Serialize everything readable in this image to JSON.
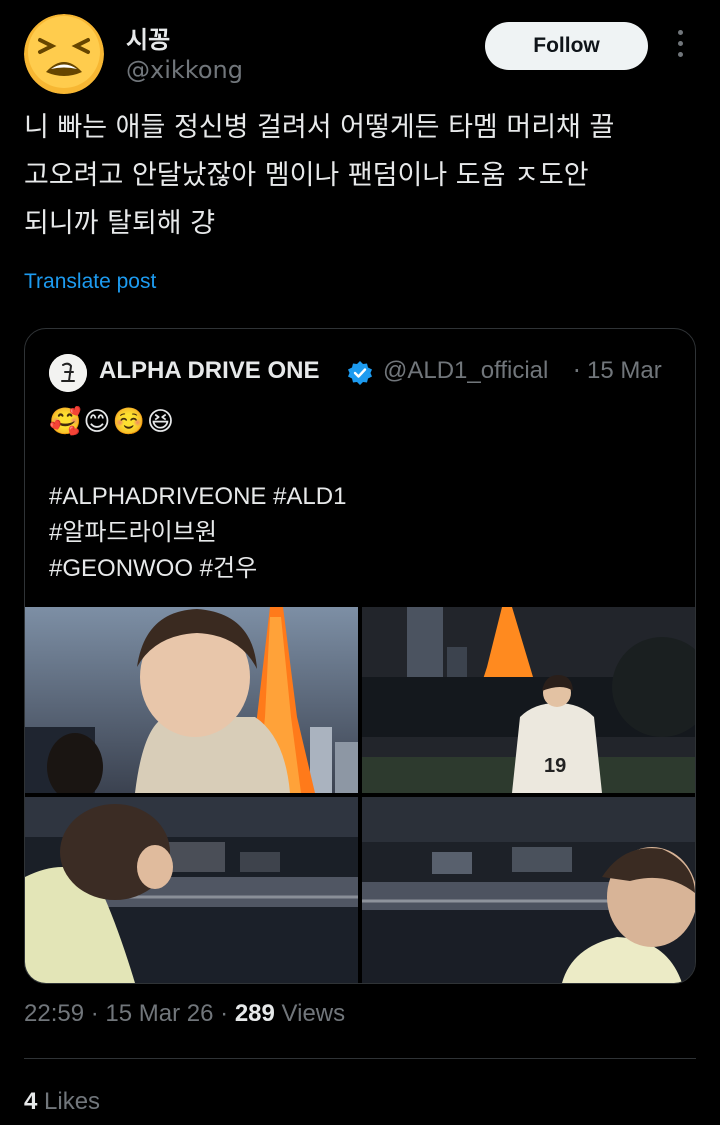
{
  "author": {
    "display_name": "시꽁",
    "handle": "@xikkong",
    "avatar_icon": "tired-face-emoji-icon"
  },
  "follow_label": "Follow",
  "post_text": "니 빠는 애들 정신병 걸려서 어떻게든 타멤 머리채 끌\n고오려고 안달났잖아 멤이나 팬덤이나 도움 ㅈ도안\n되니까 탈퇴해 걍",
  "translate_label": "Translate post",
  "quote": {
    "name": "ALPHA DRIVE ONE",
    "handle": "@ALD1_official",
    "separator": "·",
    "date": "15 Mar",
    "emojis": "🥰😊☺️😆",
    "text": "#ALPHADRIVEONE #ALD1\n#알파드라이브원\n#GEONWOO #건우",
    "photo_jersey_number": "19"
  },
  "meta": {
    "time": "22:59",
    "dot": "·",
    "date": "15 Mar 26",
    "views_count": "289",
    "views_label": "Views"
  },
  "likes": {
    "count": "4",
    "label": "Likes"
  }
}
